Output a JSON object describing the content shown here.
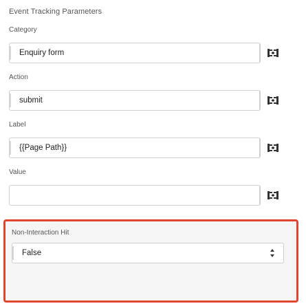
{
  "section": {
    "title": "Event Tracking Parameters"
  },
  "fields": {
    "category": {
      "label": "Category",
      "value": "Enquiry form"
    },
    "action": {
      "label": "Action",
      "value": "submit"
    },
    "label": {
      "label": "Label",
      "value": "{{Page Path}}"
    },
    "value": {
      "label": "Value",
      "value": ""
    }
  },
  "non_interaction": {
    "label": "Non-Interaction Hit",
    "selected": "False"
  },
  "icons": {
    "variable_picker": "variable-picker-icon",
    "select_arrows": "select-arrows-icon"
  },
  "colors": {
    "highlight_border": "#e0452f",
    "icon": "#333333"
  }
}
